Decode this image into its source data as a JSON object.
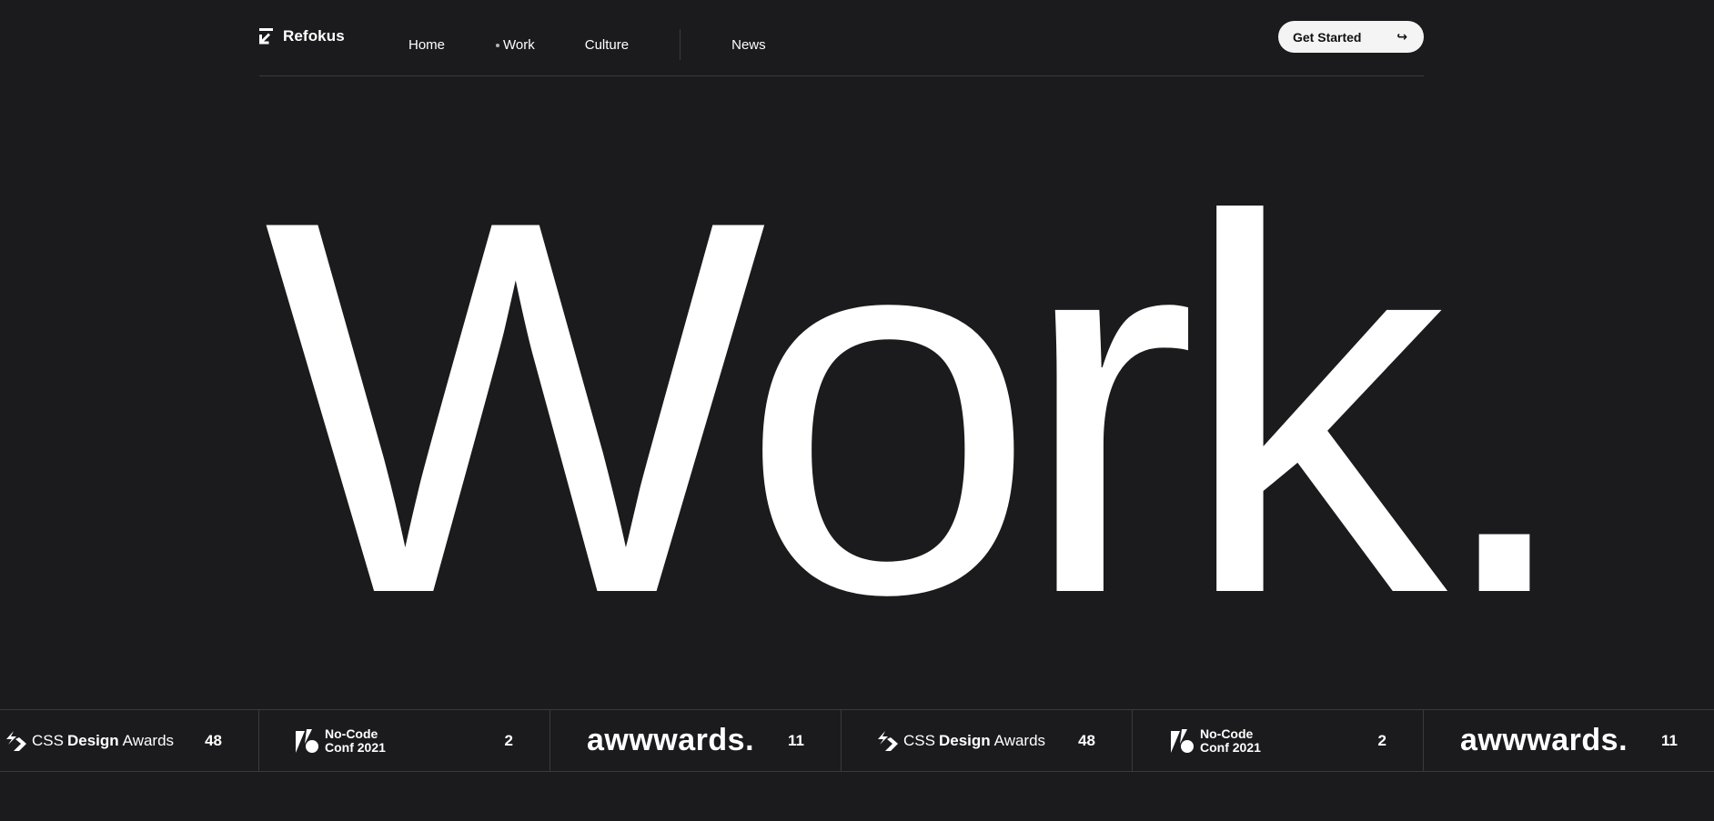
{
  "header": {
    "brand": "Refokus",
    "nav": [
      "Home",
      "Work",
      "Culture",
      "News"
    ],
    "cta_label": "Get Started",
    "cta_icon": "arrow-return-icon"
  },
  "hero": {
    "title": "Work."
  },
  "awards": [
    {
      "org_prefix": "CSS",
      "org_bold": "Design",
      "org_suffix": "Awards",
      "count": "48"
    },
    {
      "org_line1": "No-Code",
      "org_line2": "Conf 2021",
      "count": "2"
    },
    {
      "org": "awwwards.",
      "count": "11"
    },
    {
      "org_prefix": "CSS",
      "org_bold": "Design",
      "org_suffix": "Awards",
      "count": "48"
    },
    {
      "org_line1": "No-Code",
      "org_line2": "Conf 2021",
      "count": "2"
    },
    {
      "org": "awwwards.",
      "count": "11"
    }
  ],
  "colors": {
    "background": "#1b1b1d",
    "text": "#ffffff",
    "cta_bg": "#f4f4f4",
    "divider": "#3a3a3c"
  }
}
